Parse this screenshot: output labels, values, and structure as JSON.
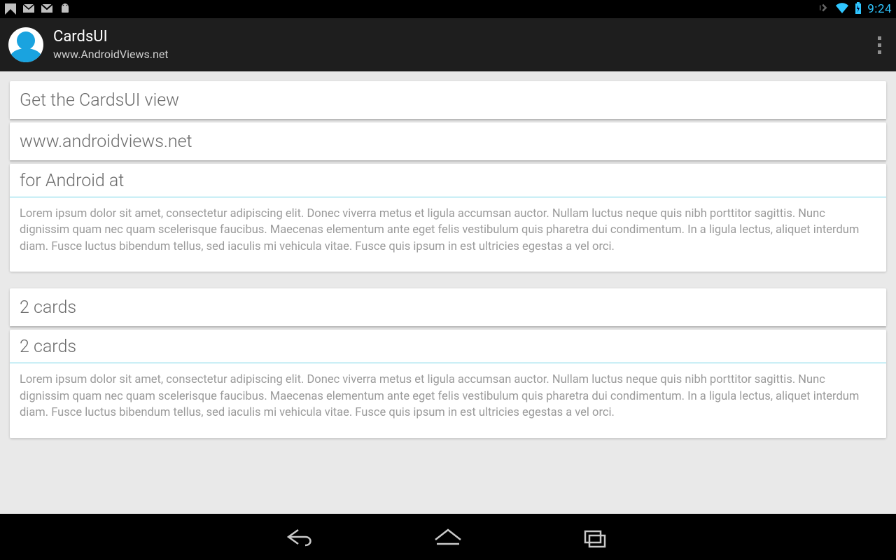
{
  "status_bar": {
    "time": "9:24"
  },
  "action_bar": {
    "title": "CardsUI",
    "subtitle": "www.AndroidViews.net"
  },
  "lorem": "Lorem ipsum dolor sit amet, consectetur adipiscing elit. Donec viverra metus et ligula accumsan auctor. Nullam luctus neque quis nibh porttitor sagittis. Nunc dignissim quam nec quam scelerisque faucibus. Maecenas elementum ante eget felis vestibulum quis pharetra dui condimentum. In a ligula lectus, aliquet interdum diam. Fusce luctus bibendum tellus, sed iaculis mi vehicula vitae. Fusce quis ipsum in est ultricies egestas a vel orci.",
  "stacks": [
    {
      "peeks": [
        "Get the CardsUI view",
        "www.androidviews.net"
      ],
      "top_title": "for Android at"
    },
    {
      "peeks": [
        "2 cards"
      ],
      "top_title": "2 cards"
    }
  ]
}
